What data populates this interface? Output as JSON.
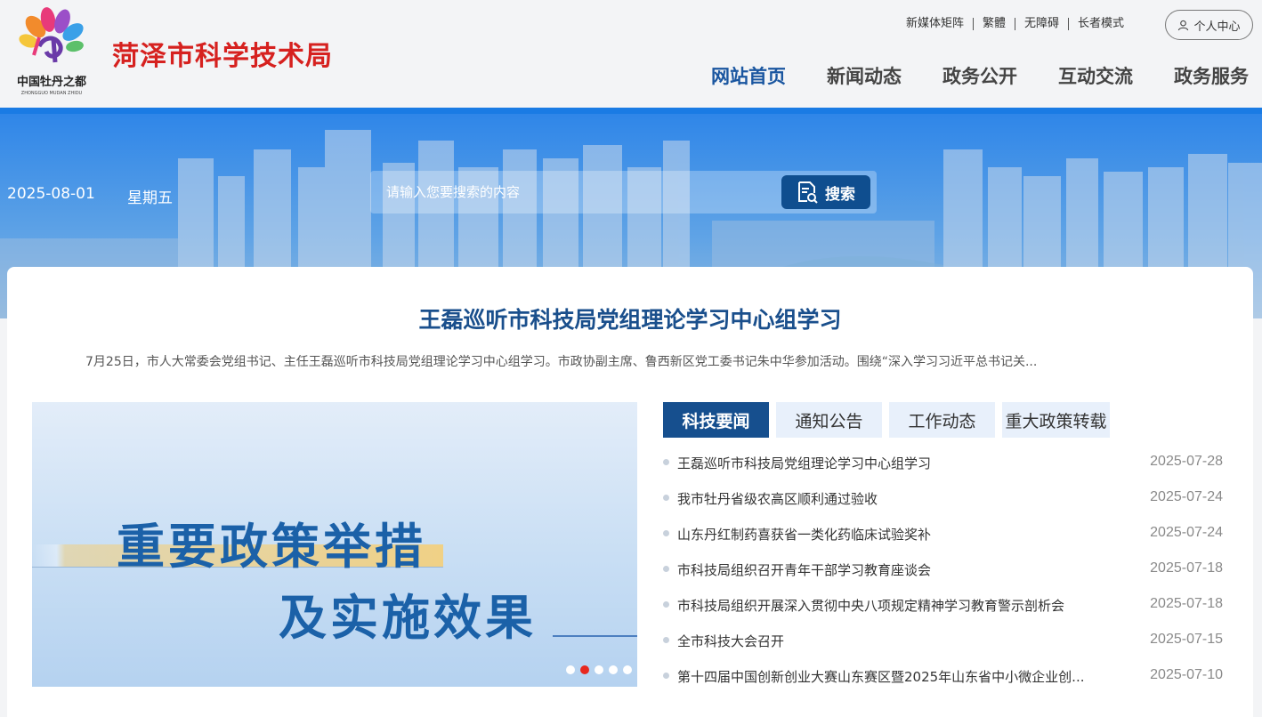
{
  "header": {
    "site_title": "菏泽市科学技术局",
    "logo_alt": "中国牡丹之都",
    "top_links": [
      "新媒体矩阵",
      "繁體",
      "无障碍",
      "长者模式"
    ],
    "user_center": "个人中心",
    "nav": [
      "网站首页",
      "新闻动态",
      "政务公开",
      "互动交流",
      "政务服务"
    ]
  },
  "banner": {
    "date": "2025-08-01",
    "weekday": "星期五",
    "search_placeholder": "请输入您要搜索的内容",
    "search_button": "搜索"
  },
  "headline": {
    "title": "王磊巡听市科技局党组理论学习中心组学习",
    "summary": "7月25日，市人大常委会党组书记、主任王磊巡听市科技局党组理论学习中心组学习。市政协副主席、鲁西新区党工委书记朱中华参加活动。围绕“深入学习习近平总书记关..."
  },
  "slider": {
    "line1": "重要政策举措",
    "line2": "及实施效果",
    "dots": 5,
    "active_index": 1
  },
  "tabs": [
    "科技要闻",
    "通知公告",
    "工作动态",
    "重大政策转载"
  ],
  "news": [
    {
      "title": "王磊巡听市科技局党组理论学习中心组学习",
      "date": "2025-07-28"
    },
    {
      "title": "我市牡丹省级农高区顺利通过验收",
      "date": "2025-07-24"
    },
    {
      "title": "山东丹红制药喜获省一类化药临床试验奖补",
      "date": "2025-07-24"
    },
    {
      "title": "市科技局组织召开青年干部学习教育座谈会",
      "date": "2025-07-18"
    },
    {
      "title": "市科技局组织开展深入贯彻中央八项规定精神学习教育警示剖析会",
      "date": "2025-07-18"
    },
    {
      "title": "全市科技大会召开",
      "date": "2025-07-15"
    },
    {
      "title": "第十四届中国创新创业大赛山东赛区暨2025年山东省中小微企业创...",
      "date": "2025-07-10"
    }
  ],
  "colors": {
    "brand_red": "#d6211f",
    "brand_blue": "#164f8e",
    "accent_blue": "#1a7be4"
  }
}
